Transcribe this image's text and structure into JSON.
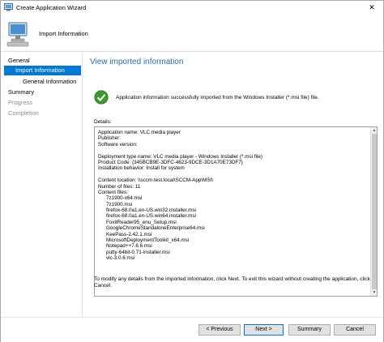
{
  "window": {
    "title": "Create Application Wizard",
    "close_glyph": "✕"
  },
  "header": {
    "step_title": "Import Information",
    "icon": "computer-wizard-icon"
  },
  "nav": {
    "items": [
      {
        "label": "General",
        "state": "normal"
      },
      {
        "label": "Import Information",
        "state": "selected"
      },
      {
        "label": "General Information",
        "state": "normal"
      },
      {
        "label": "Summary",
        "state": "normal"
      },
      {
        "label": "Progress",
        "state": "disabled"
      },
      {
        "label": "Completion",
        "state": "disabled"
      }
    ]
  },
  "content": {
    "view_title": "View imported information",
    "status_text": "Application information successfully imported from the Windows Installer (*.msi file) file.",
    "details_label": "Details:",
    "details_lines": [
      "Application name: VLC media player",
      "Publisher:",
      "Software version:",
      "",
      "Deployment type name: VLC media player - Windows Installer (*.msi file)",
      "Product Code: {345BCB9E-3DFC-4623-9DCE-3D1A70E73DF7}",
      "Installation behavior: Install for system",
      "",
      "Content location: \\\\sccm.test.local\\SCCM-App\\MSI\\",
      "Number of files: 11",
      "Content files:"
    ],
    "content_files": [
      "7z1900-x64.msi",
      "7z1900.msi",
      "firefox-68.0a1.en-US.win32.installer.msi",
      "firefox-68.0a1.en-US.win64.installer.msi",
      "FoxitReader95_enu_Setup.msi",
      "GoogleChromeStandaloneEnterprise64.msi",
      "KeePass-2.42.1.msi",
      "MicrosoftDeploymentToolkit_x64.msi",
      "Notepad++7.6.6.msi",
      "putty-64bit-0.71-installer.msi",
      "vlc-3.0.6.msi"
    ],
    "footer_note": "To modify any details from the imported information, click Next. To exit this wizard without creating the application, click Cancel."
  },
  "buttons": {
    "previous": "< Previous",
    "next": "Next >",
    "summary": "Summary",
    "cancel": "Cancel"
  },
  "colors": {
    "accent": "#0078d7",
    "title_blue": "#1f6fb5",
    "success_green": "#3a9a2a",
    "disabled_text": "#8c8c8c"
  }
}
